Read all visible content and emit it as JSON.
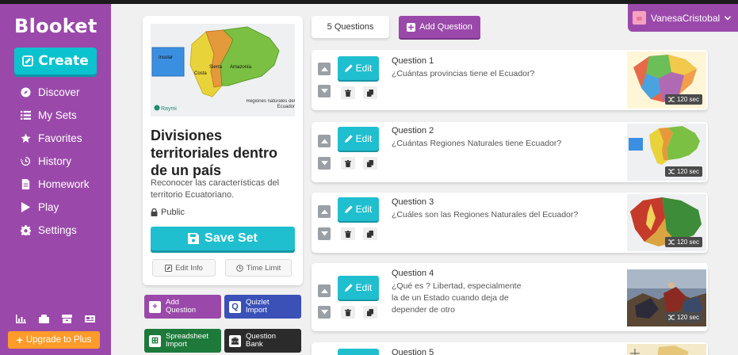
{
  "app": {
    "logo": "Blooket"
  },
  "sidebar": {
    "create_label": "Create",
    "items": [
      {
        "label": "Discover",
        "icon": "compass-icon"
      },
      {
        "label": "My Sets",
        "icon": "list-icon"
      },
      {
        "label": "Favorites",
        "icon": "star-icon"
      },
      {
        "label": "History",
        "icon": "history-icon"
      },
      {
        "label": "Homework",
        "icon": "document-icon"
      },
      {
        "label": "Play",
        "icon": "play-icon"
      },
      {
        "label": "Settings",
        "icon": "gear-icon"
      }
    ],
    "upgrade_label": "Upgrade to Plus"
  },
  "user": {
    "name": "VanesaCristobal"
  },
  "set": {
    "title": "Divisiones territoriales dentro de un país",
    "description": "Reconocer las características del territorio Ecuatoriano.",
    "privacy": "Public",
    "save_label": "Save Set",
    "edit_info_label": "Edit Info",
    "time_limit_label": "Time Limit",
    "image_labels": {
      "insular": "Insular",
      "costa": "Costa",
      "sierra": "Sierra",
      "amazonia": "Amazonía",
      "brand": "Raymi",
      "caption": "Regiones naturales del Ecuador"
    }
  },
  "quick_add": [
    {
      "label": "Add Question",
      "color": "#9a49aa",
      "icon": "+"
    },
    {
      "label": "Quizlet Import",
      "color": "#3b51b8",
      "icon": "Q"
    },
    {
      "label": "Spreadsheet Import",
      "color": "#1e7a3b",
      "icon": "⊞"
    },
    {
      "label": "Question Bank",
      "color": "#2b2b2b",
      "icon": "🏛"
    }
  ],
  "questions_header": {
    "count_label": "5 Questions",
    "add_label": "Add Question"
  },
  "edit_label": "Edit",
  "questions": [
    {
      "number": "Question 1",
      "text": "¿Cuántas provincias tiene el Ecuador?",
      "timer": "120 sec"
    },
    {
      "number": "Question 2",
      "text": "¿Cuántas Regiones Naturales tiene Ecuador?",
      "timer": "120 sec"
    },
    {
      "number": "Question 3",
      "text": "¿Cuáles son las Regiones Naturales del Ecuador?",
      "timer": "120 sec"
    },
    {
      "number": "Question 4",
      "text": "¿Qué es ? Libertad, especialmente la de un Estado cuando deja de depender de otro",
      "timer": "120 sec"
    },
    {
      "number": "Question 5",
      "text": ""
    }
  ],
  "colors": {
    "sidebar": "#9a49aa",
    "accent": "#1fbfcf",
    "upgrade": "#ff9b2a"
  }
}
